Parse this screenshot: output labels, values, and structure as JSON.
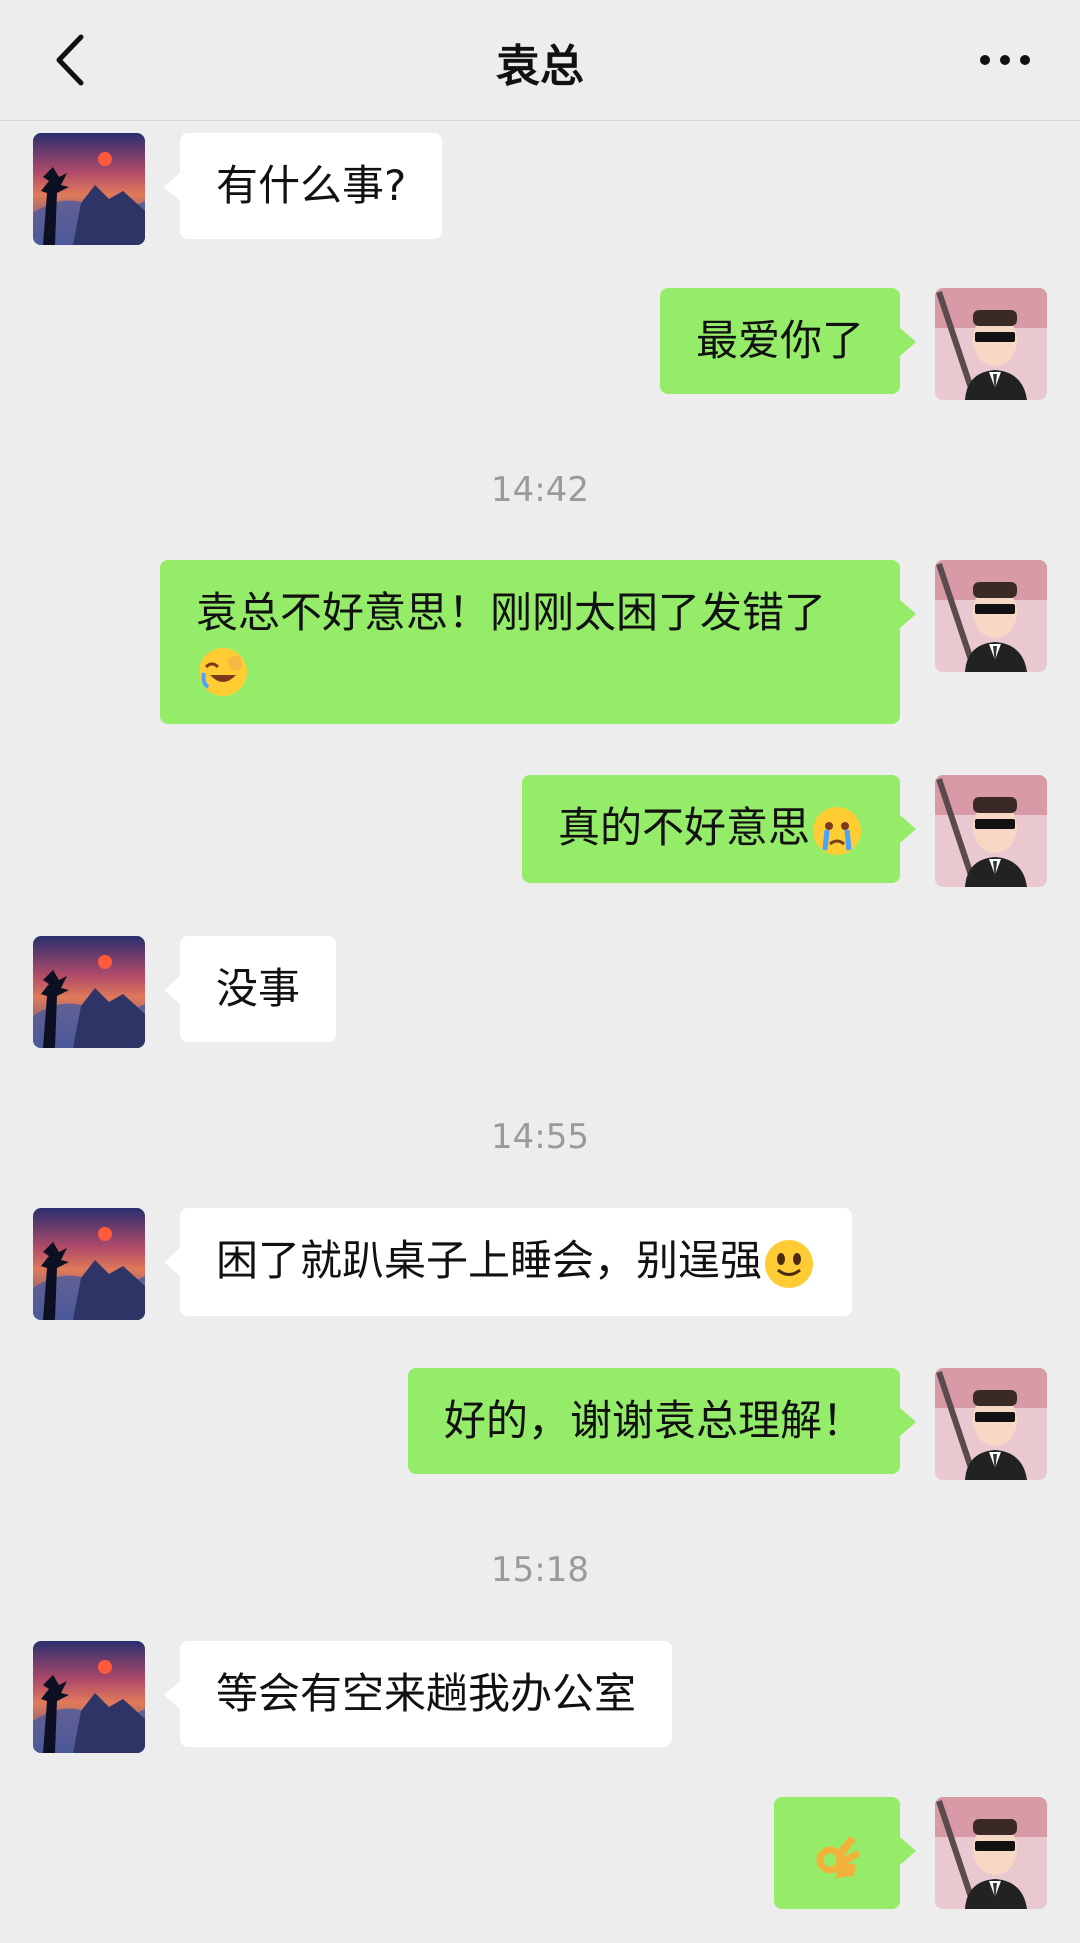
{
  "header": {
    "title": "袁总",
    "back_icon": "chevron-left-icon",
    "more_icon": "more-dots-icon"
  },
  "messages": [
    {
      "sender": "other",
      "text": "有什么事?"
    },
    {
      "sender": "me",
      "text": "最爱你了"
    },
    {
      "type": "time",
      "text": "14:42"
    },
    {
      "sender": "me",
      "text": "袁总不好意思！刚刚太困了发错了",
      "emoji": "facepalm-laugh-emoji"
    },
    {
      "sender": "me",
      "text": "真的不好意思",
      "emoji": "crying-emoji"
    },
    {
      "sender": "other",
      "text": "没事"
    },
    {
      "type": "time",
      "text": "14:55"
    },
    {
      "sender": "other",
      "text": "困了就趴桌子上睡会，别逞强",
      "emoji": "smile-emoji"
    },
    {
      "sender": "me",
      "text": "好的，谢谢袁总理解！"
    },
    {
      "type": "time",
      "text": "15:18"
    },
    {
      "sender": "other",
      "text": "等会有空来趟我办公室"
    },
    {
      "sender": "me",
      "text": "",
      "emoji": "ok-hand-emoji"
    }
  ],
  "colors": {
    "background": "#ededed",
    "my_bubble": "#95ec69",
    "other_bubble": "#ffffff",
    "timestamp": "#9a9a9a"
  }
}
